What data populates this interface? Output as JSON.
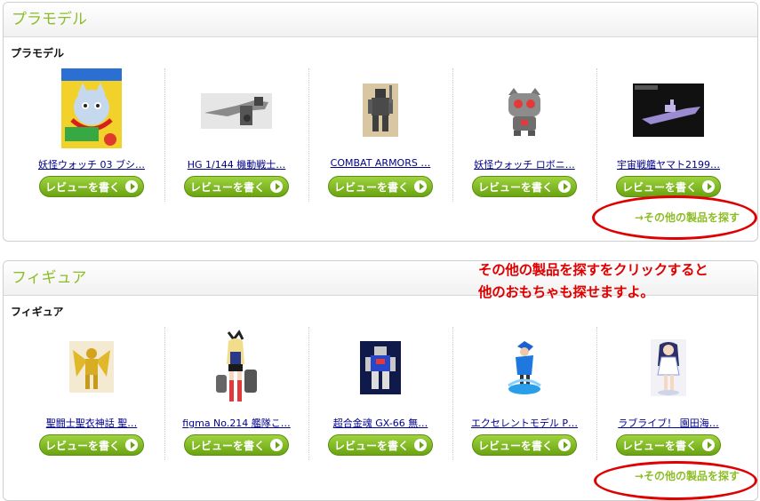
{
  "sections": [
    {
      "header": "プラモデル",
      "subtitle": "プラモデル",
      "products": [
        {
          "name": "妖怪ウォッチ 03 ブシ…",
          "icon": "jibanyan-box-image"
        },
        {
          "name": "HG 1/144 機動戦士…",
          "icon": "mecha-kit-image"
        },
        {
          "name": "COMBAT ARMORS …",
          "icon": "combat-armor-image"
        },
        {
          "name": "妖怪ウォッチ ロボニ…",
          "icon": "robonyan-image"
        },
        {
          "name": "宇宙戦艦ヤマト2199…",
          "icon": "battleship-image"
        }
      ],
      "review_label": "レビューを書く",
      "more_label": "→その他の製品を探す"
    },
    {
      "header": "フィギュア",
      "subtitle": "フィギュア",
      "products": [
        {
          "name": "聖闘士聖衣神話 聖…",
          "icon": "gold-saint-figure-image"
        },
        {
          "name": "figma No.214 艦隊こ…",
          "icon": "shimakaze-figure-image"
        },
        {
          "name": "超合金魂 GX-66 無…",
          "icon": "robot-figure-image"
        },
        {
          "name": "エクセレントモデル P…",
          "icon": "pirate-figure-image"
        },
        {
          "name": "ラブライブ！ 園田海…",
          "icon": "idol-figure-image"
        }
      ],
      "review_label": "レビューを書く",
      "more_label": "→その他の製品を探す"
    }
  ],
  "annotation": {
    "line1": "その他の製品を探すをクリックすると",
    "line2": "他のおもちゃも探せますよ。"
  },
  "colors": {
    "accent_green": "#8dbd26",
    "button_green": "#6aa311",
    "annotation_red": "#e00000",
    "link_blue": "#00008b"
  }
}
